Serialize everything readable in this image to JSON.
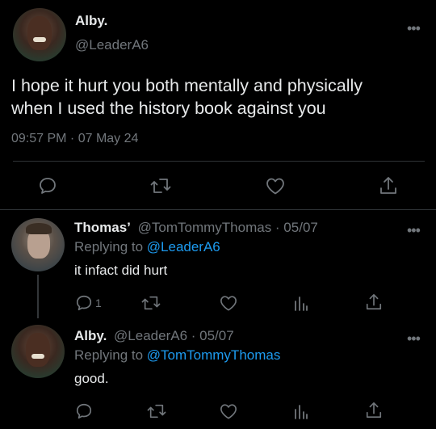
{
  "main_tweet": {
    "author_name": "Alby.",
    "author_handle": "@LeaderA6",
    "text_line1": "I hope it hurt you both mentally and physically",
    "text_line2": "when I used the history book against you",
    "time": "09:57 PM · 07 May 24",
    "more_icon": "more-dots-icon"
  },
  "reply1": {
    "author_name": "Thomas’",
    "meta": "@TomTommyThomas · 05/07",
    "replying_prefix": "Replying to ",
    "replying_handle": "@LeaderA6",
    "text": "it infact did hurt",
    "reply_count": "1"
  },
  "reply2": {
    "author_name": "Alby.",
    "meta": "@LeaderA6 · 05/07",
    "replying_prefix": "Replying to ",
    "replying_handle": "@TomTommyThomas",
    "text": "good."
  },
  "colors": {
    "background": "#000000",
    "text": "#e7e9ea",
    "muted": "#71767b",
    "link": "#1d9bf0",
    "divider": "#2f3336"
  }
}
